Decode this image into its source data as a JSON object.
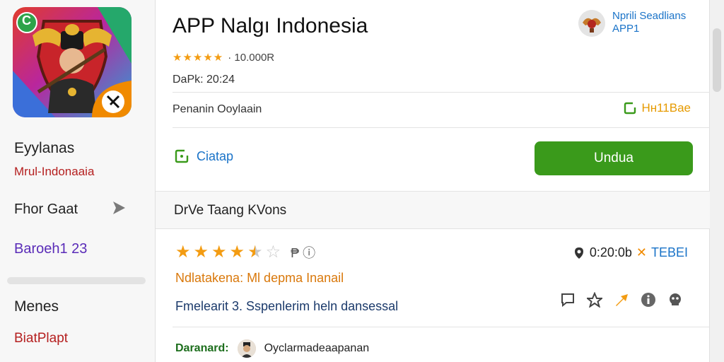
{
  "sidebar": {
    "title": "Eyylanas",
    "subtitle": "Mrul-Indonaaia",
    "row_label": "Fhor Gaat",
    "purple_text": "Baroeh1 23",
    "menu_label": "Menes",
    "red_text": "BiatPlapt",
    "icon_badge": "C"
  },
  "app": {
    "title": "APP Nalgı Indonesia",
    "stars": "★★★★★",
    "rating_text": "· 10.000R",
    "date": "DaPk: 20:24",
    "developer_label": "Penanin Ooylaain",
    "size_badge": "Hн11Bae",
    "open_link": "Ciatap",
    "install_label": "Undua",
    "publisher_line1": "Nprili Seadlians",
    "publisher_line2": "APP1"
  },
  "section": {
    "title": "DrVe Taang KVons"
  },
  "review": {
    "extra_symbols": "₱ ⓘ",
    "meta_value": "0:20:0b",
    "meta_tag": "TEBEI",
    "orange_text": "Ndlatakena: Ml depma Inanail",
    "blue_text": "Fmelearit 3. Sspenlerim heln dansessal",
    "download_label": "Daranard:",
    "download_value": "Oyclarmadeaapanan"
  },
  "colors": {
    "install_green": "#3a9a1b",
    "accent_blue": "#1a73c8",
    "star_orange": "#f39c12"
  },
  "icons": {
    "share": "share-icon",
    "pin": "pin-icon",
    "close": "close-icon",
    "wishlist": "star-outline-icon"
  }
}
